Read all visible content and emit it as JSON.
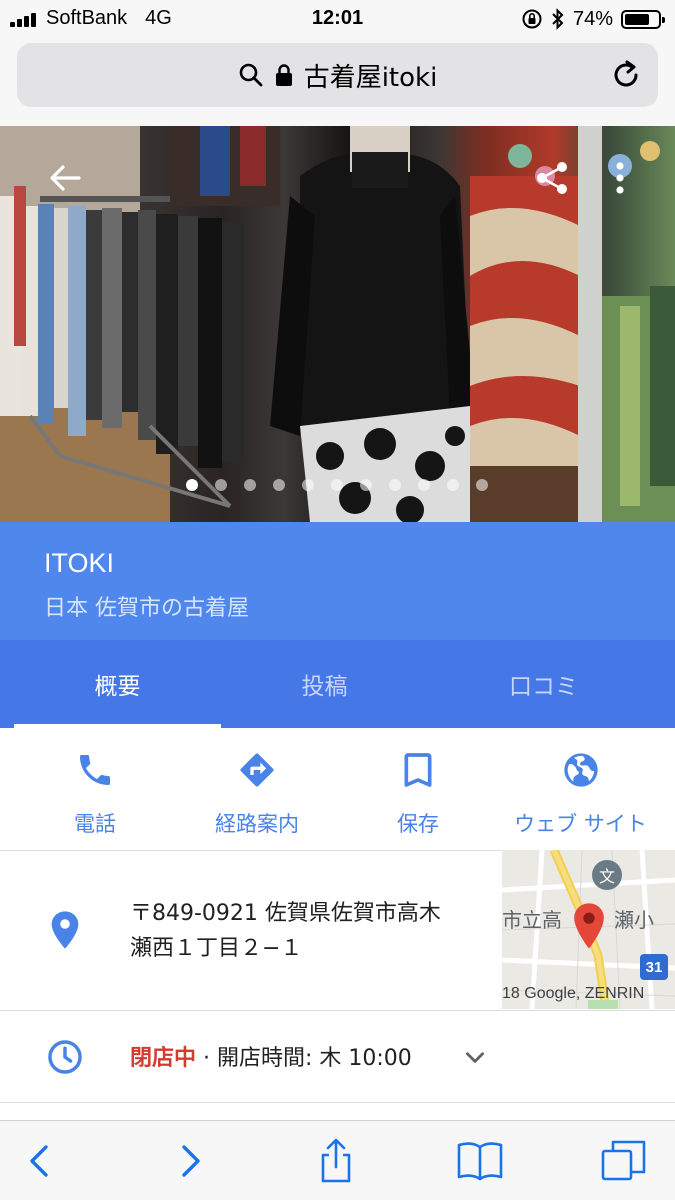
{
  "status_bar": {
    "carrier": "SoftBank",
    "network": "4G",
    "time": "12:01",
    "battery_percent": "74%",
    "battery_level": 0.74
  },
  "url_bar": {
    "title": "古着屋itoki",
    "icons": [
      "search-icon",
      "lock-icon",
      "reload-icon"
    ]
  },
  "hero": {
    "photo_count": 11,
    "active_index": 0,
    "icons": [
      "back-arrow-icon",
      "share-icon",
      "more-vert-icon"
    ]
  },
  "place": {
    "name": "ITOKI",
    "subtitle": "日本 佐賀市の古着屋"
  },
  "tabs": [
    {
      "label": "概要",
      "active": true
    },
    {
      "label": "投稿",
      "active": false
    },
    {
      "label": "口コミ",
      "active": false
    }
  ],
  "actions": [
    {
      "label": "電話",
      "icon": "phone-icon"
    },
    {
      "label": "経路案内",
      "icon": "directions-icon"
    },
    {
      "label": "保存",
      "icon": "bookmark-icon"
    },
    {
      "label": "ウェブ サイト",
      "icon": "globe-icon"
    }
  ],
  "address": {
    "line1": "〒849-0921 佐賀県佐賀市高木",
    "line2": "瀬西１丁目２−１"
  },
  "map": {
    "label_left": "市立高",
    "label_right": "瀬小",
    "school_glyph": "文",
    "route_number": "31",
    "credit": "18 Google, ZENRIN"
  },
  "hours": {
    "status": "閉店中",
    "separator": " · ",
    "detail": "開店時間: 木 10:00"
  },
  "colors": {
    "header_blue": "#4f87ec",
    "tabs_blue": "#4577e6",
    "action_blue": "#4a83e8",
    "closed_red": "#d33b30"
  }
}
